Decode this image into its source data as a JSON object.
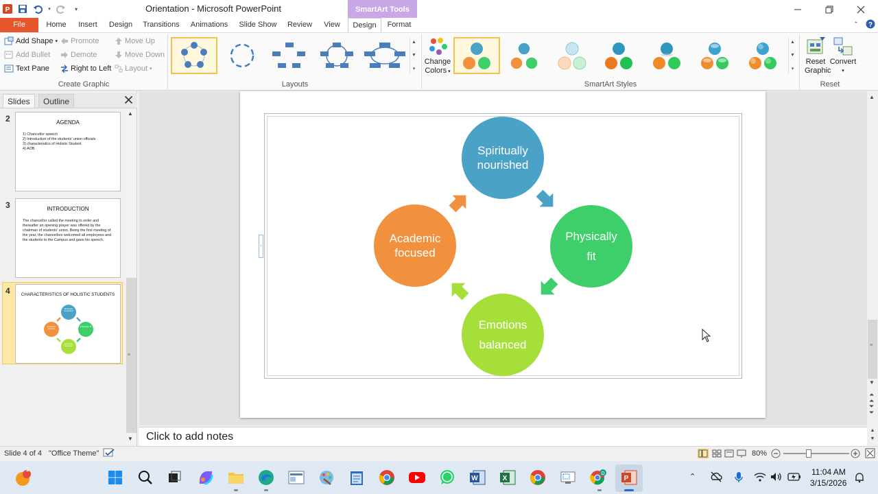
{
  "window": {
    "title": "Orientation  -  Microsoft PowerPoint",
    "contextual_group": "SmartArt Tools"
  },
  "tabs": [
    "File",
    "Home",
    "Insert",
    "Design",
    "Transitions",
    "Animations",
    "Slide Show",
    "Review",
    "View",
    "Design",
    "Format"
  ],
  "active_tab": "Design",
  "ribbon": {
    "create_graphic": {
      "label": "Create Graphic",
      "add_shape": "Add Shape",
      "add_bullet": "Add Bullet",
      "text_pane": "Text Pane",
      "promote": "Promote",
      "demote": "Demote",
      "right_to_left": "Right to Left",
      "move_up": "Move Up",
      "move_down": "Move Down",
      "layout": "Layout"
    },
    "layouts": {
      "label": "Layouts"
    },
    "smartart_styles": {
      "label": "SmartArt Styles",
      "change_colors": "Change Colors"
    },
    "reset": {
      "label": "Reset",
      "reset_graphic": "Reset Graphic",
      "convert": "Convert"
    }
  },
  "slides_pane": {
    "tabs": [
      "Slides",
      "Outline"
    ],
    "slides": [
      {
        "number": "2",
        "title": "AGENDA",
        "lines": [
          "1)  Chancellor  speech",
          "2)  Introduction  of the students'  union officials",
          "3)  characteristics  of  Holistic  Student",
          "4)  AOB"
        ]
      },
      {
        "number": "3",
        "title": "INTRODUCTION",
        "body": "The chancellor  called  the meeting  to order and thereafter  an opening  prayer was offered by the chairman of students'  union.  Being  the first meeting  of the year, the chancellors  welcomed all employees and the students  to the Campus and gave his speech."
      },
      {
        "number": "4",
        "title": "CHARACTERISTICS  OF HOLISTIC STUDENTS",
        "mini_labels": [
          "Spiritually nourished",
          "Physically fit",
          "Emotions balanced",
          "Academic focused"
        ]
      }
    ]
  },
  "smartart": {
    "nodes": [
      {
        "id": "spiritual",
        "line1": "Spiritually",
        "line2": "nourished",
        "color": "#4aa3c7"
      },
      {
        "id": "physical",
        "line1": "Physically",
        "line2": "fit",
        "color": "#3ecf6a"
      },
      {
        "id": "emotional",
        "line1": "Emotions",
        "line2": "balanced",
        "color": "#a6de3a"
      },
      {
        "id": "academic",
        "line1": "Academic",
        "line2": "focused",
        "color": "#f2913d"
      }
    ]
  },
  "notes": {
    "placeholder": "Click to add notes"
  },
  "status": {
    "slide_info": "Slide 4 of 4",
    "theme": "\"Office Theme\"",
    "zoom": "80%"
  },
  "taskbar": {
    "time": "11:04 AM",
    "date": "3/15/2026",
    "badge_count": "1"
  }
}
